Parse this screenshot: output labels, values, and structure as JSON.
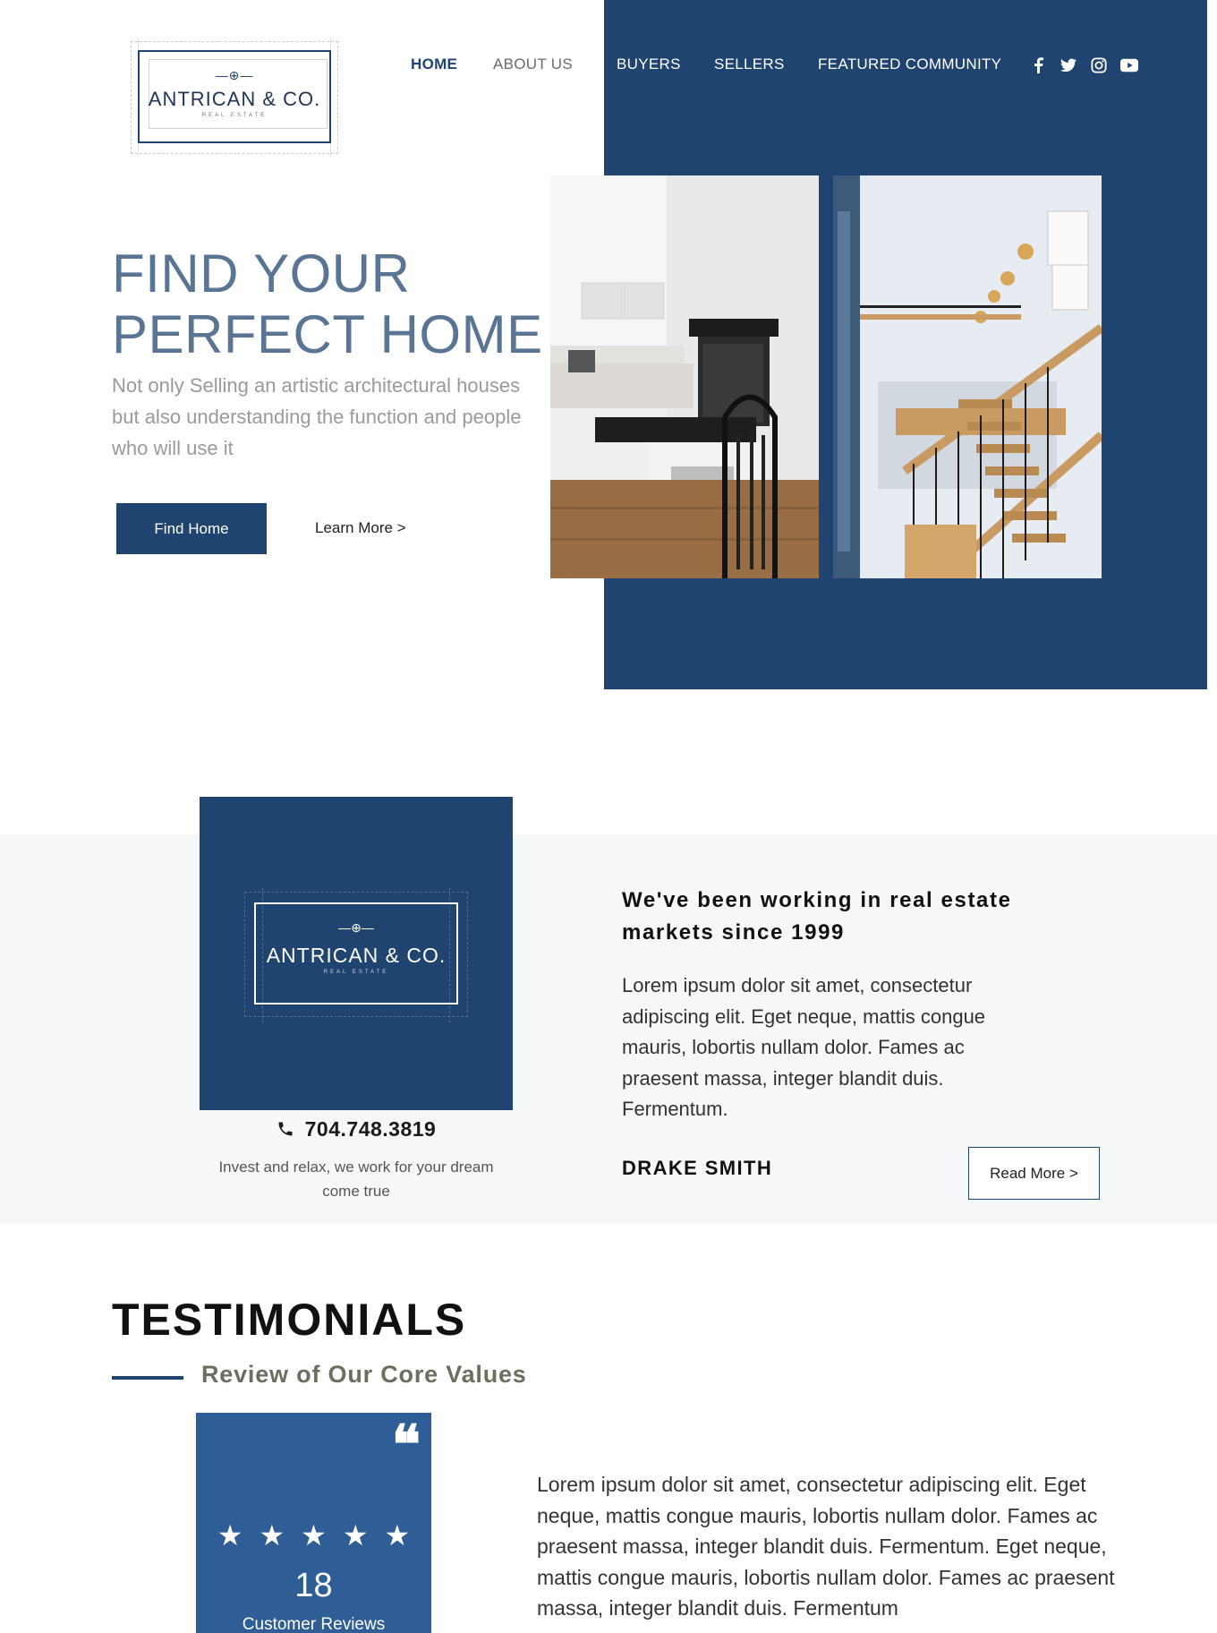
{
  "brand": {
    "name": "ANTRICAN & CO.",
    "subtitle": "REAL ESTATE"
  },
  "nav": {
    "items": [
      {
        "label": "HOME"
      },
      {
        "label": "ABOUT US"
      },
      {
        "label": "BUYERS"
      },
      {
        "label": "SELLERS"
      },
      {
        "label": "FEATURED COMMUNITY"
      }
    ],
    "social": [
      {
        "icon": "facebook-icon",
        "glyph": "f"
      },
      {
        "icon": "twitter-icon",
        "glyph": "🐦"
      },
      {
        "icon": "instagram-icon",
        "glyph": "◎"
      },
      {
        "icon": "youtube-icon",
        "glyph": "▶"
      }
    ]
  },
  "hero": {
    "title_line1": "FIND YOUR",
    "title_line2": "PERFECT HOME",
    "subtitle": "Not only Selling an artistic architectural houses but also understanding the function and people who will use it",
    "primary_button": "Find Home",
    "secondary_link": "Learn More >"
  },
  "about": {
    "phone": "704.748.3819",
    "tagline": "Invest and relax, we work for your dream come true",
    "heading": "We've been working in real estate markets since 1999",
    "body": "Lorem ipsum dolor sit amet, consectetur adipiscing elit. Eget neque, mattis congue mauris, lobortis nullam dolor. Fames ac praesent massa, integer blandit duis. Fermentum.",
    "author": "DRAKE SMITH",
    "read_more": "Read More >"
  },
  "testimonials": {
    "title": "TESTIMONIALS",
    "subtitle": "Review of Our Core Values",
    "rating_stars": 5,
    "review_count": "18",
    "review_label": "Customer Reviews",
    "body": "Lorem ipsum dolor sit amet, consectetur adipiscing elit. Eget neque, mattis congue mauris, lobortis nullam dolor. Fames ac praesent massa, integer blandit duis. Fermentum. Eget neque, mattis congue mauris, lobortis nullam dolor. Fames ac praesent massa, integer blandit duis. Fermentum"
  },
  "colors": {
    "brand_navy": "#1f446f",
    "card_blue": "#2f5d96",
    "band_bg": "#f6f7f9",
    "hero_title": "#5a7494"
  }
}
